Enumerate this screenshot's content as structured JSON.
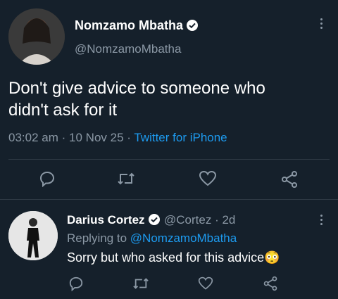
{
  "tweet": {
    "author_name": "Nomzamo Mbatha",
    "author_handle": "@NomzamoMbatha",
    "text_line1": "Don't give advice to someone who",
    "text_line2": "didn't ask for it",
    "time": "03:02 am",
    "date": "10 Nov 25",
    "source": "Twitter for iPhone",
    "sep": "·"
  },
  "reply": {
    "author_name": "Darius Cortez",
    "author_handle": "@Cortez",
    "age": "2d",
    "replying_prefix": "Replying to",
    "replying_handle": "@NomzamoMbatha",
    "text": "Sorry but who asked for this advice",
    "emoji": "😳",
    "sep": "·"
  },
  "icons": {
    "reply": "reply-icon",
    "retweet": "retweet-icon",
    "like": "heart-icon",
    "share": "share-icon",
    "verified": "verified-badge-icon",
    "more": "more-vertical-icon"
  },
  "colors": {
    "background": "#15202b",
    "accent": "#1d9bf0",
    "muted": "#8b98a5"
  }
}
